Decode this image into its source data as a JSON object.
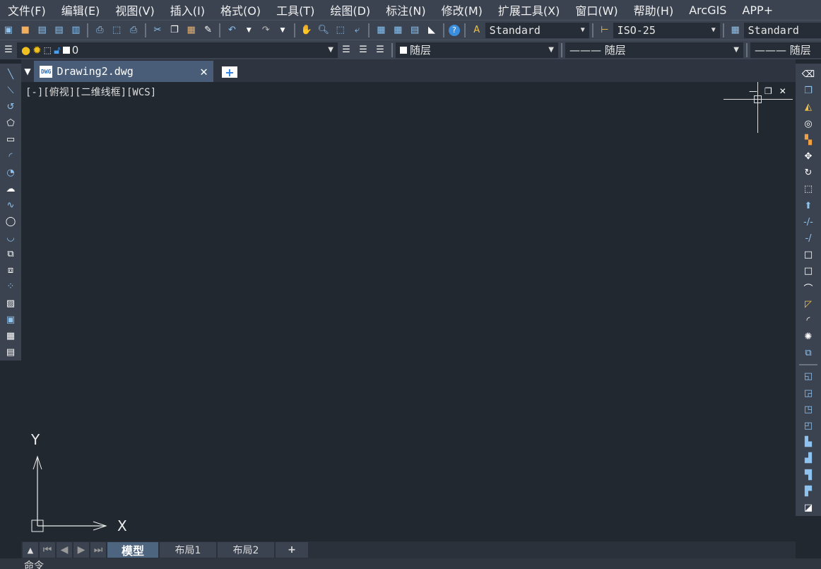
{
  "menu": [
    "文件(F)",
    "编辑(E)",
    "视图(V)",
    "插入(I)",
    "格式(O)",
    "工具(T)",
    "绘图(D)",
    "标注(N)",
    "修改(M)",
    "扩展工具(X)",
    "窗口(W)",
    "帮助(H)",
    "ArcGIS",
    "APP+"
  ],
  "toolbar": {
    "text_style": "Standard",
    "dim_style": "ISO-25",
    "table_style": "Standard",
    "layer": "0",
    "color": "随层",
    "linetype": "——— 随层",
    "lineweight": "——— 随层"
  },
  "document": {
    "tab_label": "Drawing2.dwg",
    "viewport_label": "[-][俯视][二维线框][WCS]"
  },
  "ucs": {
    "x": "X",
    "y": "Y"
  },
  "layouts": {
    "tabs": [
      "模型",
      "布局1",
      "布局2"
    ],
    "active": "模型",
    "add": "+"
  },
  "command": {
    "prompt": "命令"
  },
  "colors": {
    "canvas": "#212830",
    "chrome": "#3b4350",
    "active_tab": "#4a5d78"
  }
}
